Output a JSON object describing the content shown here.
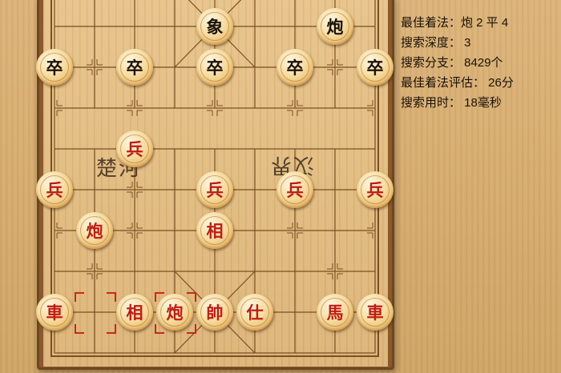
{
  "board": {
    "river_left": "楚河",
    "river_right": "汉界"
  },
  "pieces": [
    {
      "id": "black-elephant",
      "label": "象",
      "side": "black",
      "col": 4,
      "row": 1
    },
    {
      "id": "black-cannon",
      "label": "炮",
      "side": "black",
      "col": 7,
      "row": 1
    },
    {
      "id": "black-soldier-1",
      "label": "卒",
      "side": "black",
      "col": 0,
      "row": 2
    },
    {
      "id": "black-soldier-2",
      "label": "卒",
      "side": "black",
      "col": 2,
      "row": 2
    },
    {
      "id": "black-soldier-3",
      "label": "卒",
      "side": "black",
      "col": 4,
      "row": 2
    },
    {
      "id": "black-soldier-4",
      "label": "卒",
      "side": "black",
      "col": 6,
      "row": 2
    },
    {
      "id": "black-soldier-5",
      "label": "卒",
      "side": "black",
      "col": 8,
      "row": 2
    },
    {
      "id": "red-soldier-crossed",
      "label": "兵",
      "side": "red",
      "col": 2,
      "row": 4
    },
    {
      "id": "red-soldier-1",
      "label": "兵",
      "side": "red",
      "col": 0,
      "row": 5
    },
    {
      "id": "red-soldier-2",
      "label": "兵",
      "side": "red",
      "col": 4,
      "row": 5
    },
    {
      "id": "red-soldier-3",
      "label": "兵",
      "side": "red",
      "col": 6,
      "row": 5
    },
    {
      "id": "red-soldier-4",
      "label": "兵",
      "side": "red",
      "col": 8,
      "row": 5
    },
    {
      "id": "red-cannon-1",
      "label": "炮",
      "side": "red",
      "col": 1,
      "row": 6
    },
    {
      "id": "red-elephant-1",
      "label": "相",
      "side": "red",
      "col": 4,
      "row": 6
    },
    {
      "id": "red-chariot-1",
      "label": "車",
      "side": "red",
      "col": 0,
      "row": 8
    },
    {
      "id": "red-elephant-2",
      "label": "相",
      "side": "red",
      "col": 2,
      "row": 8
    },
    {
      "id": "red-cannon-2",
      "label": "炮",
      "side": "red",
      "col": 3,
      "row": 8
    },
    {
      "id": "red-general",
      "label": "帥",
      "side": "red",
      "col": 4,
      "row": 8
    },
    {
      "id": "red-advisor",
      "label": "仕",
      "side": "red",
      "col": 5,
      "row": 8
    },
    {
      "id": "red-horse",
      "label": "馬",
      "side": "red",
      "col": 7,
      "row": 8
    },
    {
      "id": "red-chariot-2",
      "label": "車",
      "side": "red",
      "col": 8,
      "row": 8
    }
  ],
  "last_move_markers": [
    {
      "col": 1,
      "row": 8
    },
    {
      "col": 3,
      "row": 8
    }
  ],
  "info": {
    "best_move": "最佳着法：炮 2 平 4",
    "depth": "搜索深度：  3",
    "branches": "搜索分支：  8429个",
    "evaluation": "最佳着法评估：  26分",
    "time": "搜索用时：  18毫秒"
  },
  "colors": {
    "red_piece_text": "#c21a12",
    "black_piece_text": "#1b1208",
    "marker": "#c8281a"
  }
}
